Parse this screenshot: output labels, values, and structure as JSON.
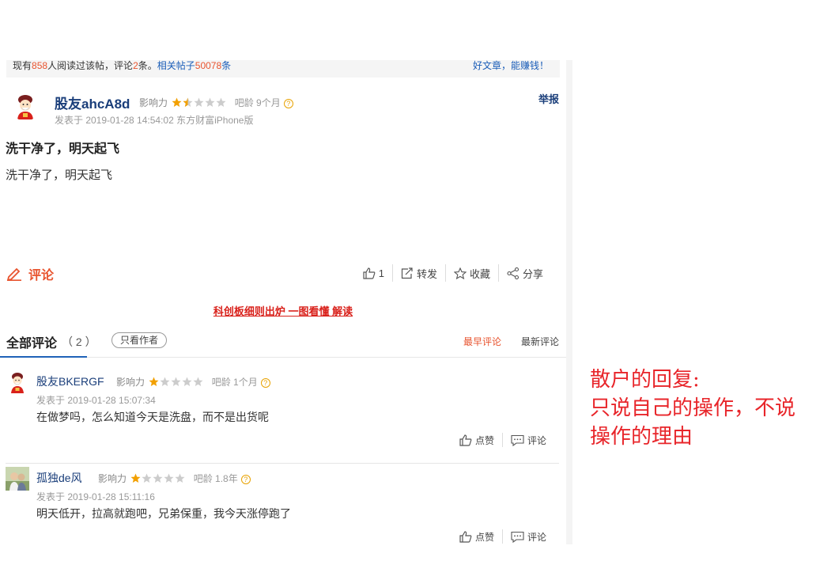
{
  "stats": {
    "prefix": "现有",
    "readers": "858",
    "readers_suffix": "人阅读过该帖，评论",
    "comments": "2",
    "comments_suffix": "条。",
    "related_prefix": "相关帖子",
    "related": "50078",
    "related_suffix": "条",
    "slogan": "好文章，能赚钱！"
  },
  "post": {
    "username": "股友ahcA8d",
    "influence_label": "影响力",
    "influence_stars": 1.5,
    "age_label": "吧龄 9个月",
    "report": "举报",
    "date": "发表于 2019-01-28 14:54:02 东方财富iPhone版",
    "title": "洗干净了，明天起飞",
    "body": "洗干净了，明天起飞"
  },
  "actions": {
    "comment": "评论",
    "like_count": "1",
    "repost": "转发",
    "favorite": "收藏",
    "share": "分享"
  },
  "promo": "科创板细则出炉 一图看懂 解读",
  "comments_header": {
    "title": "全部评论",
    "count": "（ 2 ）",
    "only_author": "只看作者",
    "sort_hot": "最早评论",
    "sort_new": "最新评论"
  },
  "comments": [
    {
      "username": "股友BKERGF",
      "influence_label": "影响力",
      "influence_stars": 1,
      "age_label": "吧龄 1个月",
      "date": "发表于 2019-01-28 15:07:34",
      "text": "在做梦吗，怎么知道今天是洗盘，而不是出货呢",
      "like": "点赞",
      "reply": "评论"
    },
    {
      "username": "孤独de风",
      "influence_label": "影响力",
      "influence_stars": 1,
      "age_label": "吧龄 1.8年",
      "date": "发表于 2019-01-28 15:11:16",
      "text": "明天低开，拉高就跑吧，兄弟保重，我今天涨停跑了",
      "like": "点赞",
      "reply": "评论"
    }
  ],
  "annotation": {
    "line1": "散户的回复:",
    "line2": "只说自己的操作，不说",
    "line3": "操作的理由"
  },
  "colors": {
    "accent_orange": "#e8542f",
    "link_blue": "#1a5db8",
    "username_blue": "#1a3e7a",
    "annotation_red": "#e8252a",
    "promo_red": "#d9211b"
  }
}
